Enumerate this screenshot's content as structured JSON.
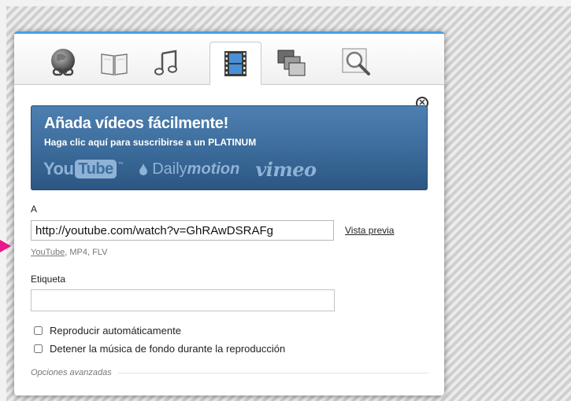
{
  "tabs": [
    {
      "name": "globe-link-icon",
      "active": false
    },
    {
      "name": "book-icon",
      "active": false
    },
    {
      "name": "music-note-icon",
      "active": false
    },
    {
      "name": "film-icon",
      "active": true
    },
    {
      "name": "gallery-icon",
      "active": false
    },
    {
      "name": "search-icon",
      "active": false
    }
  ],
  "banner": {
    "title": "Añada vídeos fácilmente!",
    "subtitle": "Haga clic aquí para suscribirse a un PLATINUM",
    "logos": {
      "youtube_you": "You",
      "youtube_tube": "Tube",
      "youtube_tm": "™",
      "dailymotion_a": "Daily",
      "dailymotion_b": "motion",
      "vimeo": "vimeo"
    }
  },
  "form": {
    "url_label": "A",
    "url_value": "http://youtube.com/watch?v=GhRAwDSRAFg",
    "preview_link": "Vista previa",
    "formats_youtube": "YouTube",
    "formats_rest": ", MP4, FLV",
    "tag_label": "Etiqueta",
    "tag_value": "",
    "autoplay_label": "Reproducir automáticamente",
    "stop_music_label": "Detener la música de fondo durante la reproducción",
    "advanced_label": "Opciones avanzadas"
  },
  "colors": {
    "accent": "#4aa0e6",
    "banner": "#3e6f9f",
    "pointer": "#e8178a"
  }
}
